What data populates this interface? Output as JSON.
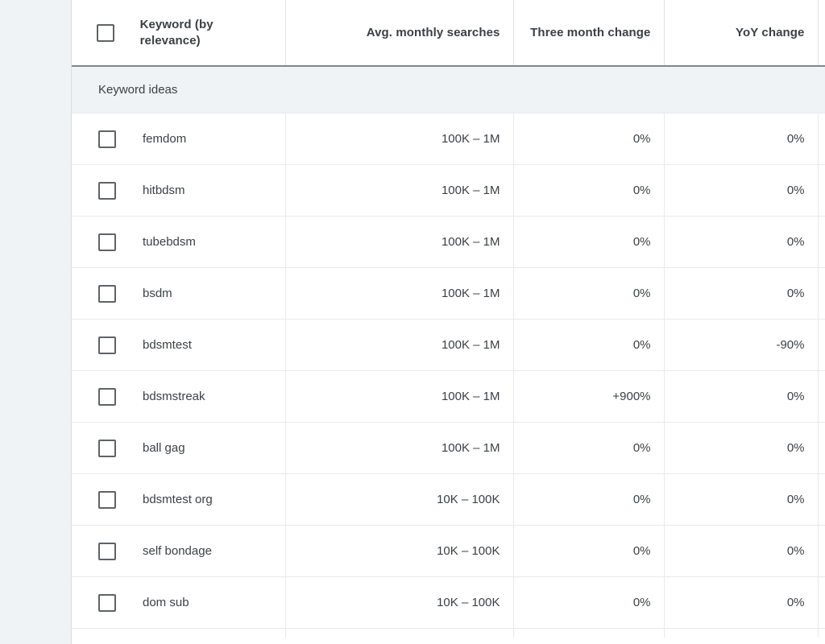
{
  "table": {
    "columns": [
      {
        "id": "keyword",
        "label": "Keyword (by relevance)",
        "align": "left"
      },
      {
        "id": "avg_monthly_searches",
        "label": "Avg. monthly searches",
        "align": "right"
      },
      {
        "id": "three_month_change",
        "label": "Three month change",
        "align": "right"
      },
      {
        "id": "yoy_change",
        "label": "YoY change",
        "align": "right"
      }
    ],
    "select_all_checkbox": {
      "checked": false,
      "icon": "checkbox-unchecked-icon"
    },
    "section_label": "Keyword ideas",
    "rows": [
      {
        "checked": false,
        "keyword": "femdom",
        "avg_monthly_searches": "100K – 1M",
        "three_month_change": "0%",
        "yoy_change": "0%"
      },
      {
        "checked": false,
        "keyword": "hitbdsm",
        "avg_monthly_searches": "100K – 1M",
        "three_month_change": "0%",
        "yoy_change": "0%"
      },
      {
        "checked": false,
        "keyword": "tubebdsm",
        "avg_monthly_searches": "100K – 1M",
        "three_month_change": "0%",
        "yoy_change": "0%"
      },
      {
        "checked": false,
        "keyword": "bsdm",
        "avg_monthly_searches": "100K – 1M",
        "three_month_change": "0%",
        "yoy_change": "0%"
      },
      {
        "checked": false,
        "keyword": "bdsmtest",
        "avg_monthly_searches": "100K – 1M",
        "three_month_change": "0%",
        "yoy_change": "-90%"
      },
      {
        "checked": false,
        "keyword": "bdsmstreak",
        "avg_monthly_searches": "100K – 1M",
        "three_month_change": "+900%",
        "yoy_change": "0%"
      },
      {
        "checked": false,
        "keyword": "ball gag",
        "avg_monthly_searches": "100K – 1M",
        "three_month_change": "0%",
        "yoy_change": "0%"
      },
      {
        "checked": false,
        "keyword": "bdsmtest org",
        "avg_monthly_searches": "10K – 100K",
        "three_month_change": "0%",
        "yoy_change": "0%"
      },
      {
        "checked": false,
        "keyword": "self bondage",
        "avg_monthly_searches": "10K – 100K",
        "three_month_change": "0%",
        "yoy_change": "0%"
      },
      {
        "checked": false,
        "keyword": "dom sub",
        "avg_monthly_searches": "10K – 100K",
        "three_month_change": "0%",
        "yoy_change": "0%"
      }
    ]
  },
  "colors": {
    "page_background": "#eff3f6",
    "table_background": "#ffffff",
    "text_primary": "#3c4043",
    "grid_line": "#e8eaed",
    "header_underline": "#80868b",
    "checkbox_border": "#5f6368"
  }
}
